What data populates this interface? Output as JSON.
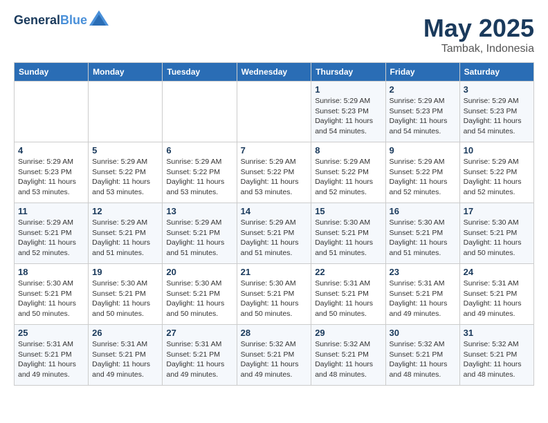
{
  "logo": {
    "line1": "General",
    "line2": "Blue"
  },
  "title": "May 2025",
  "location": "Tambak, Indonesia",
  "days_of_week": [
    "Sunday",
    "Monday",
    "Tuesday",
    "Wednesday",
    "Thursday",
    "Friday",
    "Saturday"
  ],
  "weeks": [
    [
      {
        "day": "",
        "info": ""
      },
      {
        "day": "",
        "info": ""
      },
      {
        "day": "",
        "info": ""
      },
      {
        "day": "",
        "info": ""
      },
      {
        "day": "1",
        "info": "Sunrise: 5:29 AM\nSunset: 5:23 PM\nDaylight: 11 hours\nand 54 minutes."
      },
      {
        "day": "2",
        "info": "Sunrise: 5:29 AM\nSunset: 5:23 PM\nDaylight: 11 hours\nand 54 minutes."
      },
      {
        "day": "3",
        "info": "Sunrise: 5:29 AM\nSunset: 5:23 PM\nDaylight: 11 hours\nand 54 minutes."
      }
    ],
    [
      {
        "day": "4",
        "info": "Sunrise: 5:29 AM\nSunset: 5:23 PM\nDaylight: 11 hours\nand 53 minutes."
      },
      {
        "day": "5",
        "info": "Sunrise: 5:29 AM\nSunset: 5:22 PM\nDaylight: 11 hours\nand 53 minutes."
      },
      {
        "day": "6",
        "info": "Sunrise: 5:29 AM\nSunset: 5:22 PM\nDaylight: 11 hours\nand 53 minutes."
      },
      {
        "day": "7",
        "info": "Sunrise: 5:29 AM\nSunset: 5:22 PM\nDaylight: 11 hours\nand 53 minutes."
      },
      {
        "day": "8",
        "info": "Sunrise: 5:29 AM\nSunset: 5:22 PM\nDaylight: 11 hours\nand 52 minutes."
      },
      {
        "day": "9",
        "info": "Sunrise: 5:29 AM\nSunset: 5:22 PM\nDaylight: 11 hours\nand 52 minutes."
      },
      {
        "day": "10",
        "info": "Sunrise: 5:29 AM\nSunset: 5:22 PM\nDaylight: 11 hours\nand 52 minutes."
      }
    ],
    [
      {
        "day": "11",
        "info": "Sunrise: 5:29 AM\nSunset: 5:21 PM\nDaylight: 11 hours\nand 52 minutes."
      },
      {
        "day": "12",
        "info": "Sunrise: 5:29 AM\nSunset: 5:21 PM\nDaylight: 11 hours\nand 51 minutes."
      },
      {
        "day": "13",
        "info": "Sunrise: 5:29 AM\nSunset: 5:21 PM\nDaylight: 11 hours\nand 51 minutes."
      },
      {
        "day": "14",
        "info": "Sunrise: 5:29 AM\nSunset: 5:21 PM\nDaylight: 11 hours\nand 51 minutes."
      },
      {
        "day": "15",
        "info": "Sunrise: 5:30 AM\nSunset: 5:21 PM\nDaylight: 11 hours\nand 51 minutes."
      },
      {
        "day": "16",
        "info": "Sunrise: 5:30 AM\nSunset: 5:21 PM\nDaylight: 11 hours\nand 51 minutes."
      },
      {
        "day": "17",
        "info": "Sunrise: 5:30 AM\nSunset: 5:21 PM\nDaylight: 11 hours\nand 50 minutes."
      }
    ],
    [
      {
        "day": "18",
        "info": "Sunrise: 5:30 AM\nSunset: 5:21 PM\nDaylight: 11 hours\nand 50 minutes."
      },
      {
        "day": "19",
        "info": "Sunrise: 5:30 AM\nSunset: 5:21 PM\nDaylight: 11 hours\nand 50 minutes."
      },
      {
        "day": "20",
        "info": "Sunrise: 5:30 AM\nSunset: 5:21 PM\nDaylight: 11 hours\nand 50 minutes."
      },
      {
        "day": "21",
        "info": "Sunrise: 5:30 AM\nSunset: 5:21 PM\nDaylight: 11 hours\nand 50 minutes."
      },
      {
        "day": "22",
        "info": "Sunrise: 5:31 AM\nSunset: 5:21 PM\nDaylight: 11 hours\nand 50 minutes."
      },
      {
        "day": "23",
        "info": "Sunrise: 5:31 AM\nSunset: 5:21 PM\nDaylight: 11 hours\nand 49 minutes."
      },
      {
        "day": "24",
        "info": "Sunrise: 5:31 AM\nSunset: 5:21 PM\nDaylight: 11 hours\nand 49 minutes."
      }
    ],
    [
      {
        "day": "25",
        "info": "Sunrise: 5:31 AM\nSunset: 5:21 PM\nDaylight: 11 hours\nand 49 minutes."
      },
      {
        "day": "26",
        "info": "Sunrise: 5:31 AM\nSunset: 5:21 PM\nDaylight: 11 hours\nand 49 minutes."
      },
      {
        "day": "27",
        "info": "Sunrise: 5:31 AM\nSunset: 5:21 PM\nDaylight: 11 hours\nand 49 minutes."
      },
      {
        "day": "28",
        "info": "Sunrise: 5:32 AM\nSunset: 5:21 PM\nDaylight: 11 hours\nand 49 minutes."
      },
      {
        "day": "29",
        "info": "Sunrise: 5:32 AM\nSunset: 5:21 PM\nDaylight: 11 hours\nand 48 minutes."
      },
      {
        "day": "30",
        "info": "Sunrise: 5:32 AM\nSunset: 5:21 PM\nDaylight: 11 hours\nand 48 minutes."
      },
      {
        "day": "31",
        "info": "Sunrise: 5:32 AM\nSunset: 5:21 PM\nDaylight: 11 hours\nand 48 minutes."
      }
    ]
  ]
}
